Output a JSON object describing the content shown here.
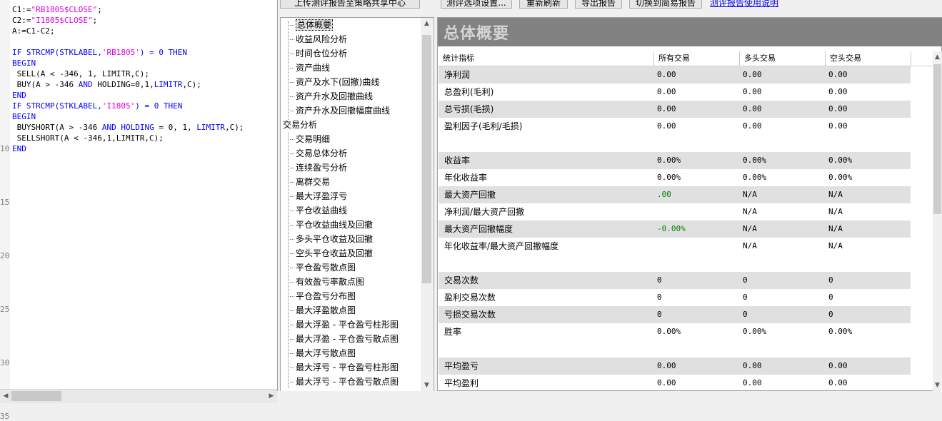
{
  "editor": {
    "line_numbers": [
      "10",
      "15",
      "20",
      "25",
      "30",
      "35"
    ],
    "code_lines": [
      [
        {
          "t": "C1:=",
          "c": ""
        },
        {
          "t": "\"RB1805$CLOSE\"",
          "c": "st"
        },
        {
          "t": ";",
          "c": ""
        }
      ],
      [
        {
          "t": "C2:=",
          "c": ""
        },
        {
          "t": "\"I1805$CLOSE\"",
          "c": "st"
        },
        {
          "t": ";",
          "c": ""
        }
      ],
      [
        {
          "t": "A:=C1-C2;",
          "c": ""
        }
      ],
      [],
      [
        {
          "t": "IF STRCMP(STKLABEL,",
          "c": "kw"
        },
        {
          "t": "'RB1805'",
          "c": "st"
        },
        {
          "t": ") = 0 THEN",
          "c": "kw"
        }
      ],
      [
        {
          "t": "BEGIN",
          "c": "kw"
        }
      ],
      [
        {
          "t": " SELL(A < -346, 1, LIMITR,C);",
          "c": ""
        }
      ],
      [
        {
          "t": " BUY(A > -346 ",
          "c": ""
        },
        {
          "t": "AND",
          "c": "kw"
        },
        {
          "t": " HOLDING=0,1,",
          "c": ""
        },
        {
          "t": "LIMITR",
          "c": "kw"
        },
        {
          "t": ",C);",
          "c": ""
        }
      ],
      [
        {
          "t": "END",
          "c": "kw"
        }
      ],
      [
        {
          "t": "IF STRCMP(STKLABEL,",
          "c": "kw"
        },
        {
          "t": "'I1805'",
          "c": "st"
        },
        {
          "t": ") = 0 THEN",
          "c": "kw"
        }
      ],
      [
        {
          "t": "BEGIN",
          "c": "kw"
        }
      ],
      [
        {
          "t": " BUYSHORT(A > -346 ",
          "c": ""
        },
        {
          "t": "AND HOLDING",
          "c": "kw"
        },
        {
          "t": " = 0, 1, ",
          "c": ""
        },
        {
          "t": "LIMITR",
          "c": "kw"
        },
        {
          "t": ",C);",
          "c": ""
        }
      ],
      [
        {
          "t": " SELLSHORT(A < -346,1,LIMITR,C);",
          "c": ""
        }
      ],
      [
        {
          "t": "END",
          "c": "kw"
        }
      ]
    ]
  },
  "toolbar": {
    "upload_label": "上传测评报告至策略共享中心",
    "options_label": "测评选项设置...",
    "refresh_label": "重新刷新",
    "export_label": "导出报告",
    "switch_label": "切换到简易报告",
    "help_link": "测评报告使用说明"
  },
  "tree": {
    "items": [
      {
        "label": "总体概要",
        "child": true,
        "selected": true
      },
      {
        "label": "收益风险分析",
        "child": true
      },
      {
        "label": "时间仓位分析",
        "child": true
      },
      {
        "label": "资产曲线",
        "child": true
      },
      {
        "label": "资产及水下(回撤)曲线",
        "child": true
      },
      {
        "label": "资产升水及回撤曲线",
        "child": true
      },
      {
        "label": "资产升水及回撤幅度曲线",
        "child": true
      },
      {
        "label": "交易分析",
        "child": false
      },
      {
        "label": "交易明细",
        "child": true
      },
      {
        "label": "交易总体分析",
        "child": true
      },
      {
        "label": "连续盈亏分析",
        "child": true
      },
      {
        "label": "离群交易",
        "child": true
      },
      {
        "label": "最大浮盈浮亏",
        "child": true
      },
      {
        "label": "平仓收益曲线",
        "child": true
      },
      {
        "label": "平仓收益曲线及回撤",
        "child": true
      },
      {
        "label": "多头平仓收益及回撤",
        "child": true
      },
      {
        "label": "空头平仓收益及回撤",
        "child": true
      },
      {
        "label": "平仓盈亏散点图",
        "child": true
      },
      {
        "label": "有效盈亏率散点图",
        "child": true
      },
      {
        "label": "平仓盈亏分布图",
        "child": true
      },
      {
        "label": "最大浮盈散点图",
        "child": true
      },
      {
        "label": "最大浮盈 - 平仓盈亏柱形图",
        "child": true
      },
      {
        "label": "最大浮盈 - 平仓盈亏散点图",
        "child": true
      },
      {
        "label": "最大浮亏散点图",
        "child": true
      },
      {
        "label": "最大浮亏 - 平仓盈亏柱形图",
        "child": true
      },
      {
        "label": "最大浮亏 - 平仓盈亏散点图",
        "child": true
      }
    ]
  },
  "report": {
    "title": "总体概要",
    "columns": [
      "统计指标",
      "所有交易",
      "多头交易",
      "空头交易"
    ],
    "rows": [
      {
        "label": "净利润",
        "all": "0.00",
        "long": "0.00",
        "short": "0.00",
        "shade": true
      },
      {
        "label": "总盈利(毛利)",
        "all": "0.00",
        "long": "0.00",
        "short": "0.00",
        "shade": false
      },
      {
        "label": "总亏损(毛损)",
        "all": "0.00",
        "long": "0.00",
        "short": "0.00",
        "shade": true
      },
      {
        "label": "盈利因子(毛利/毛损)",
        "all": "0.00",
        "long": "0.00",
        "short": "0.00",
        "shade": false
      },
      {
        "gap": true
      },
      {
        "label": "收益率",
        "all": "0.00%",
        "long": "0.00%",
        "short": "0.00%",
        "shade": true
      },
      {
        "label": "年化收益率",
        "all": "0.00%",
        "long": "0.00%",
        "short": "0.00%",
        "shade": false
      },
      {
        "label": "最大资产回撤",
        "all": ".00",
        "long": "N/A",
        "short": "N/A",
        "shade": true,
        "all_green": true
      },
      {
        "label": "净利润/最大资产回撤",
        "all": "",
        "long": "N/A",
        "short": "N/A",
        "shade": false
      },
      {
        "label": "最大资产回撤幅度",
        "all": "-0.00%",
        "long": "N/A",
        "short": "N/A",
        "shade": true,
        "all_green": true
      },
      {
        "label": "年化收益率/最大资产回撤幅度",
        "all": "",
        "long": "N/A",
        "short": "N/A",
        "shade": false
      },
      {
        "gap": true
      },
      {
        "label": "交易次数",
        "all": "0",
        "long": "0",
        "short": "0",
        "shade": true
      },
      {
        "label": "盈利交易次数",
        "all": "0",
        "long": "0",
        "short": "0",
        "shade": false
      },
      {
        "label": "亏损交易次数",
        "all": "0",
        "long": "0",
        "short": "0",
        "shade": true
      },
      {
        "label": "胜率",
        "all": "0.00%",
        "long": "0.00%",
        "short": "0.00%",
        "shade": false
      },
      {
        "gap": true
      },
      {
        "label": "平均盈亏",
        "all": "0.00",
        "long": "0.00",
        "short": "0.00",
        "shade": true
      },
      {
        "label": "平均盈利",
        "all": "0.00",
        "long": "0.00",
        "short": "0.00",
        "shade": false
      }
    ]
  }
}
